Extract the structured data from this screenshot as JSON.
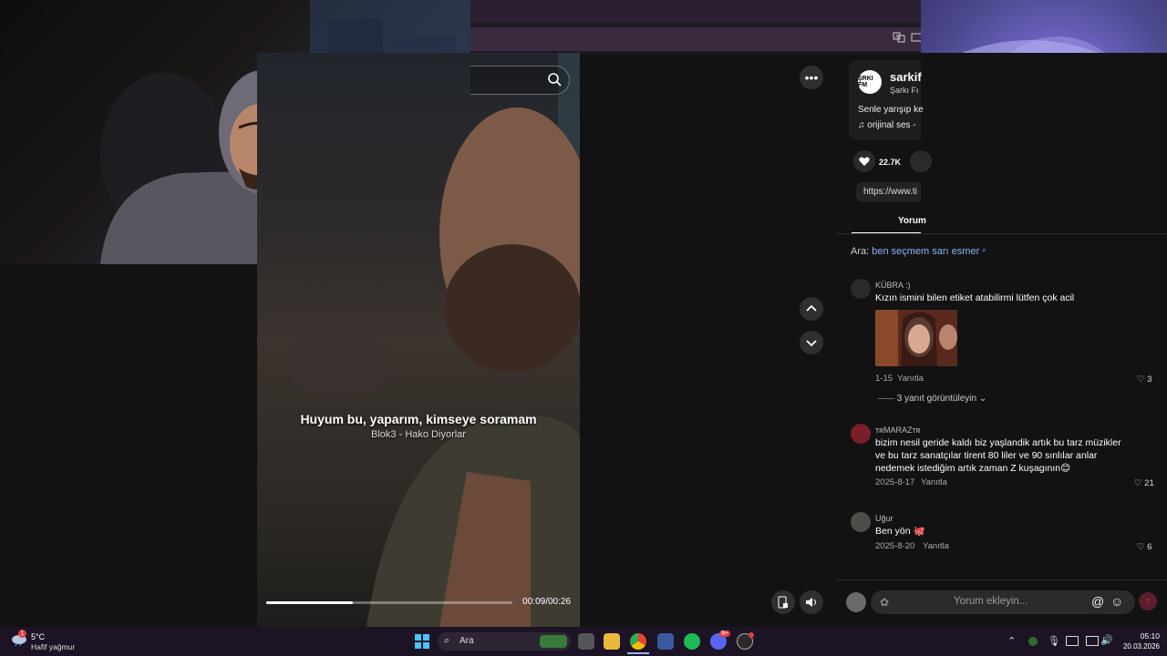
{
  "video": {
    "caption_title": "Huyum bu, yaparım, kimseye soramam",
    "caption_subtitle": "Blok3 - Hako Diyorlar",
    "time": "00:09/00:26",
    "progress": 0.35
  },
  "author": {
    "name": "sarkif",
    "handle": "Şarkı Fı",
    "avatar_text": "ŞRKI FM",
    "description": "Senle yarışıp ke",
    "sound": "orijinal ses -"
  },
  "stats": {
    "likes": "22.7K"
  },
  "link": {
    "text": "https://www.ti"
  },
  "tabs": {
    "comments": "Yorum"
  },
  "search_suggestion": {
    "prefix": "Ara:",
    "query": "ben seçmem sarı esmer"
  },
  "comments": [
    {
      "user": "KÜBRA :)",
      "text": "Kızın ismini bilen etiket atabilirmi lütfen çok acil",
      "date": "1-15",
      "reply": "Yanıtla",
      "likes": "3",
      "view_replies": "3 yanıt görüntüleyin"
    },
    {
      "user": "ᴛʀMARAZᴛʀ",
      "text": "bizim nesil geride kaldı biz yaşlandik artık bu tarz müzikler ve bu tarz sanatçılar tirent 80 liler ve 90 sınlılar anlar nedemek istediğim artık zaman Z kuşagının😊",
      "date": "2025-8-17",
      "reply": "Yanıtla",
      "likes": "21"
    },
    {
      "user": "Uğur",
      "text": "Ben yön 🐙",
      "date": "2025-8-20",
      "reply": "Yanıtla",
      "likes": "6"
    }
  ],
  "comment_input": {
    "placeholder": "Yorum ekleyin..."
  },
  "taskbar": {
    "weather_temp": "5°C",
    "weather_desc": "Hafif yağmur",
    "weather_badge": "1",
    "search_label": "Ara",
    "time": "05:10",
    "date": "20.03.2026",
    "discord_badge": "9+"
  },
  "colors": {
    "accent_red": "#fe2c55",
    "link_blue": "#8ab4f8",
    "taskbar": "#1c1424"
  }
}
